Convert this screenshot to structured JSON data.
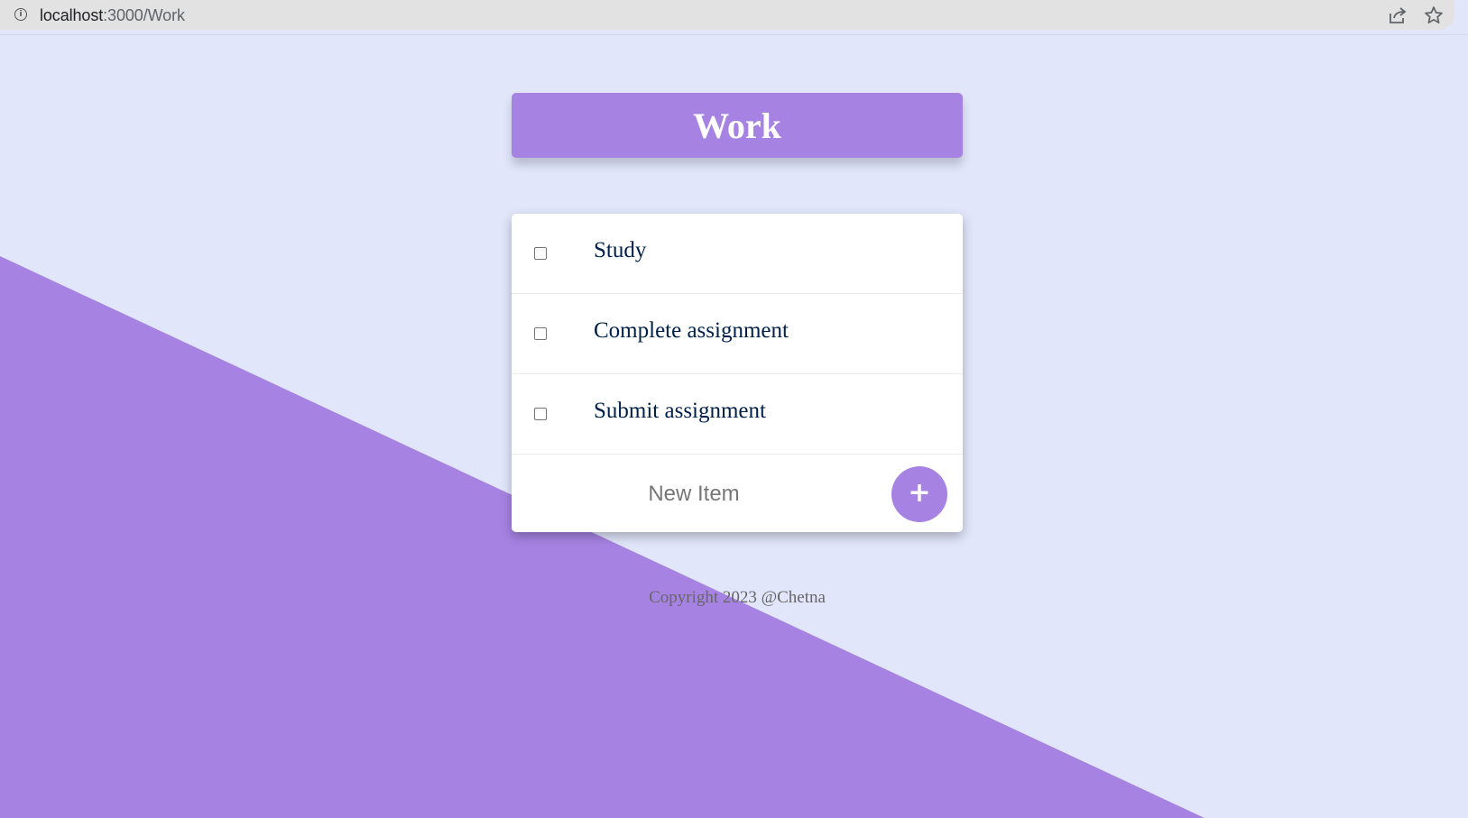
{
  "browser": {
    "url_host": "localhost",
    "url_path": ":3000/Work"
  },
  "colors": {
    "accent": "#a683e3",
    "background": "#e1e6fb",
    "item_text": "#00204a"
  },
  "header": {
    "title": "Work"
  },
  "list": {
    "items": [
      {
        "label": "Study",
        "checked": false
      },
      {
        "label": "Complete assignment",
        "checked": false
      },
      {
        "label": "Submit assignment",
        "checked": false
      }
    ],
    "new_item_placeholder": "New Item",
    "add_button_label": "+"
  },
  "footer": {
    "text": "Copyright 2023 @Chetna"
  }
}
